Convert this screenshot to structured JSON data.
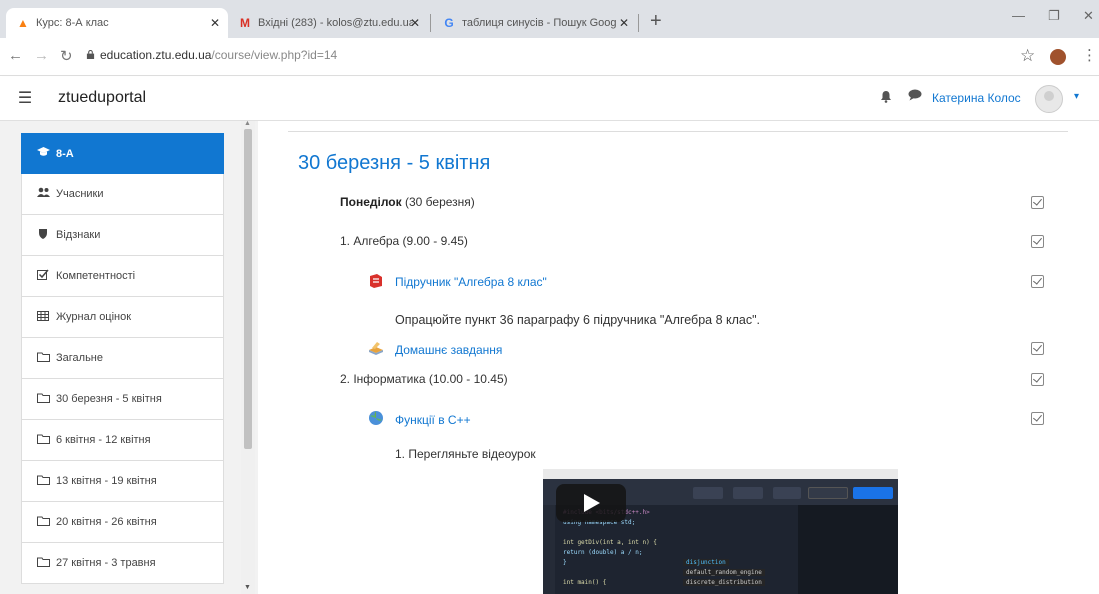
{
  "browser": {
    "tabs": [
      {
        "title": "Курс: 8-А клас",
        "favicon": "moodle-hat-icon",
        "active": true
      },
      {
        "title": "Вхідні (283) - kolos@ztu.edu.ua - ",
        "favicon": "gmail-icon",
        "active": false
      },
      {
        "title": "таблиця синусів - Пошук Goog",
        "favicon": "google-icon",
        "active": false
      }
    ],
    "new_tab": "+",
    "url_host": "education.ztu.edu.ua",
    "url_path": "/course/view.php?id=14"
  },
  "header": {
    "brand": "ztueduportal",
    "user_name": "Катерина Колос"
  },
  "sidebar": {
    "items": [
      {
        "label": "8-А",
        "icon": "graduation-cap-icon",
        "active": true
      },
      {
        "label": "Учасники",
        "icon": "users-icon"
      },
      {
        "label": "Відзнаки",
        "icon": "shield-icon"
      },
      {
        "label": "Компетентності",
        "icon": "checkbox-icon"
      },
      {
        "label": "Журнал оцінок",
        "icon": "table-icon"
      },
      {
        "label": "Загальне",
        "icon": "folder-icon"
      },
      {
        "label": "30 березня - 5 квітня",
        "icon": "folder-icon"
      },
      {
        "label": "6 квітня - 12 квітня",
        "icon": "folder-icon"
      },
      {
        "label": "13 квітня - 19 квітня",
        "icon": "folder-icon"
      },
      {
        "label": "20 квітня - 26 квітня",
        "icon": "folder-icon"
      },
      {
        "label": "27 квітня - 3 травня",
        "icon": "folder-icon"
      }
    ]
  },
  "main": {
    "section_title": "30 березня - 5 квітня",
    "day_bold": "Понеділок",
    "day_rest": " (30 березня)",
    "lesson1": "1. Алгебра (9.00 - 9.45)",
    "resource1": "Підручник \"Алгебра 8 клас\"",
    "instruction1": "Опрацюйте пункт 36 параграфу 6 підручника \"Алгебра 8 клас\".",
    "assignment1": "Домашнє завдання",
    "lesson2": "2. Інформатика (10.00 - 10.45)",
    "resource2": "Функції в С++",
    "instruction2": "1. Перегляньте відеоурок"
  },
  "video": {
    "code_lines": [
      "#include <bits/stdc++.h>",
      "using namespace std;",
      "",
      "int getDiv(int a, int n) {",
      "    return (double) a / n;",
      "}",
      "",
      "int main() {"
    ],
    "autocomplete": [
      "disjunction",
      "default_random_engine",
      "discrete_distribution"
    ]
  },
  "colors": {
    "accent": "#1177d1",
    "sidebar_bg": "#f2f2f2",
    "pdf_red": "#d9312b"
  }
}
